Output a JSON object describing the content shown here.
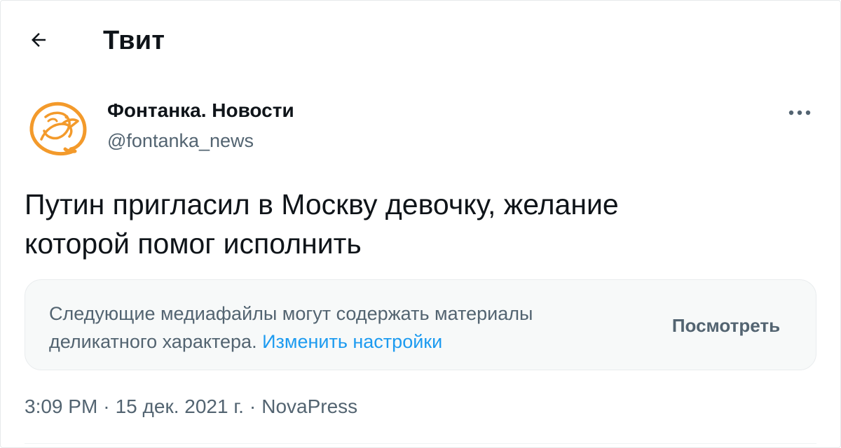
{
  "header": {
    "title": "Твит",
    "back_icon": "arrow-left-icon"
  },
  "author": {
    "name": "Фонтанка. Новости",
    "handle": "@fontanka_news",
    "avatar_icon": "fontanka-bird-logo",
    "avatar_color": "#f39a2b"
  },
  "menu": {
    "icon": "more-dots-icon"
  },
  "tweet": {
    "text": "Путин пригласил в Москву девочку, желание\nкоторой помог исполнить"
  },
  "sensitive_notice": {
    "text": "Следующие медиафайлы могут содержать материалы деликатного характера. ",
    "link": "Изменить настройки",
    "button": "Посмотреть",
    "link_color": "#1d9bf0"
  },
  "meta": {
    "time": "3:09 PM",
    "date": "15 дек. 2021 г.",
    "source": "NovaPress",
    "separator": "·"
  }
}
